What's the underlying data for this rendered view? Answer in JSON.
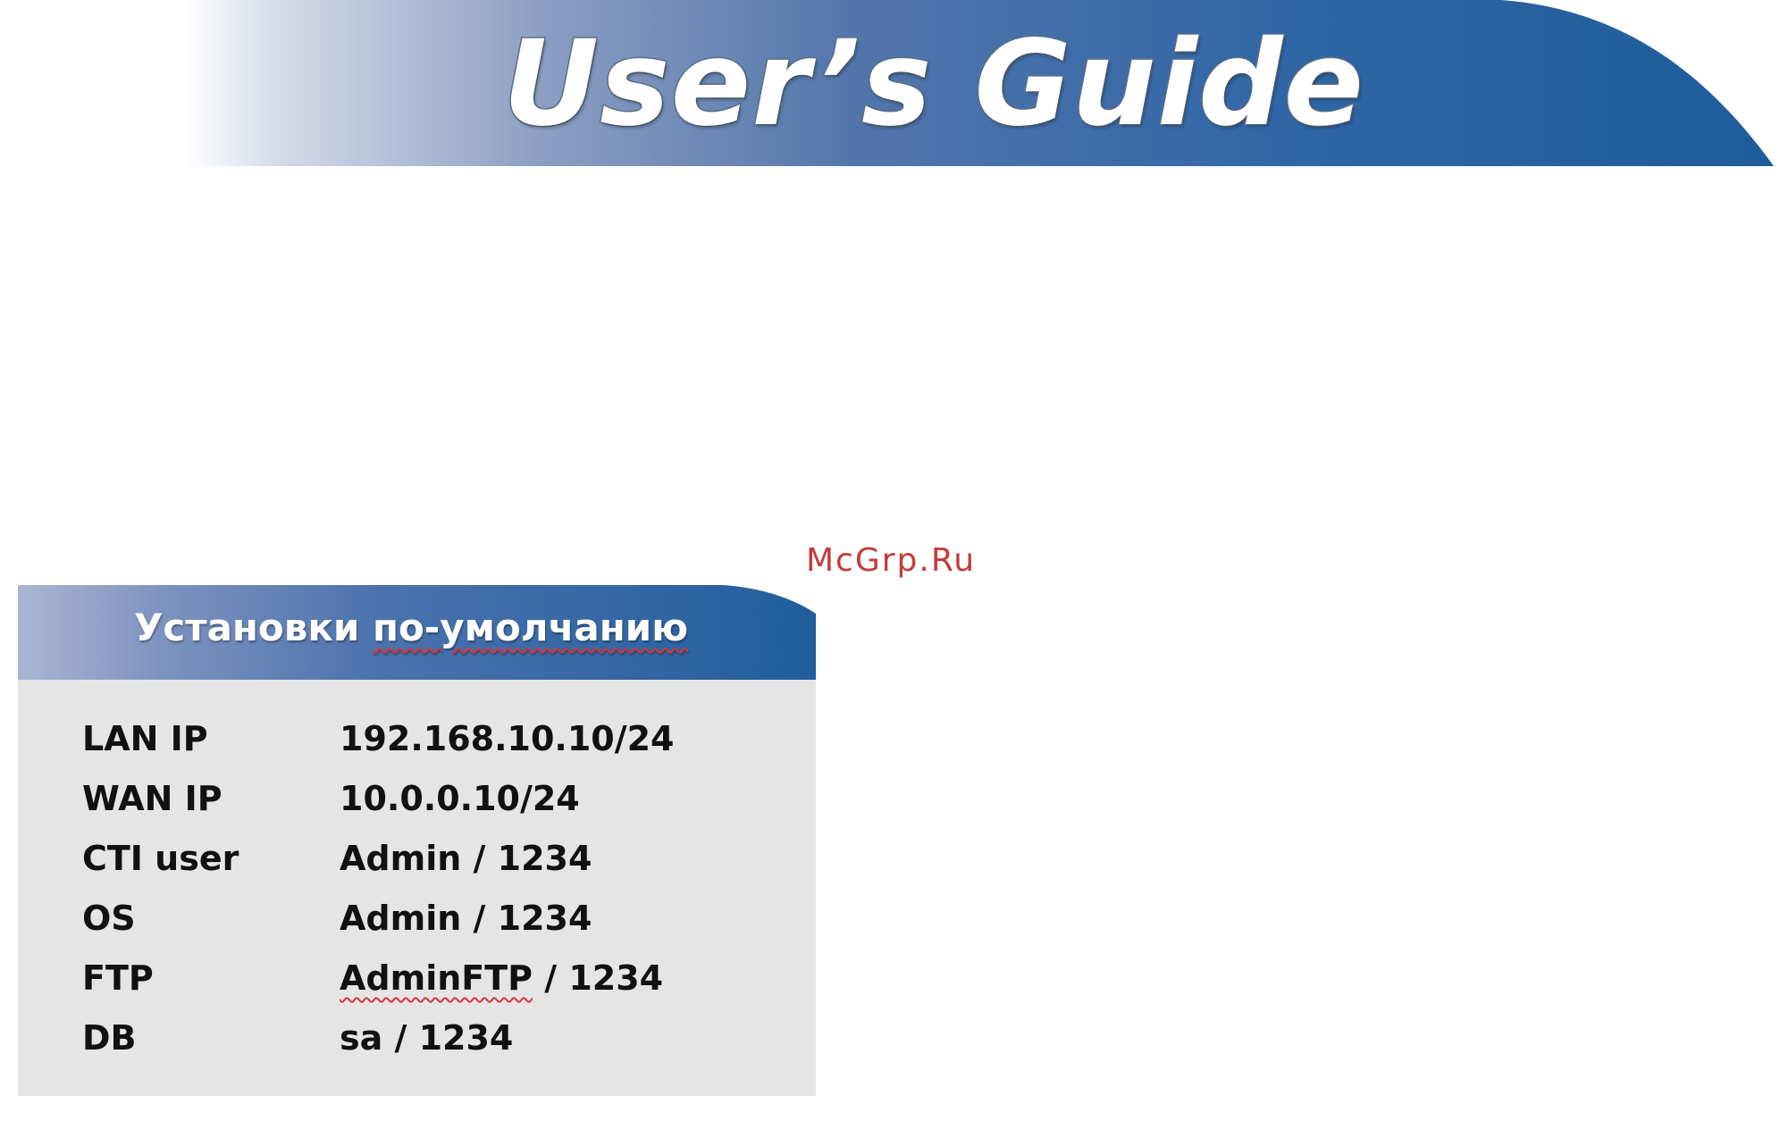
{
  "banner": {
    "title": "User’s Guide"
  },
  "watermark": {
    "text": "McGrp.Ru"
  },
  "defaults": {
    "title_part1": "Установки",
    "title_part2": "по-умолчанию",
    "rows": [
      {
        "label": "LAN IP",
        "value": "192.168.10.10/24"
      },
      {
        "label": "WAN IP",
        "value": "10.0.0.10/24"
      },
      {
        "label": "CTI user",
        "value": "Admin / 1234"
      },
      {
        "label": "OS",
        "value": "Admin / 1234"
      },
      {
        "label": "FTP",
        "value_part1": "AdminFTP",
        "value_part2": " / 1234"
      },
      {
        "label": "DB",
        "value": "sa / 1234"
      }
    ]
  },
  "colors": {
    "banner_blue": "#2a64a4",
    "panel_body": "#e5e5e5",
    "watermark": "#c63a3a"
  }
}
